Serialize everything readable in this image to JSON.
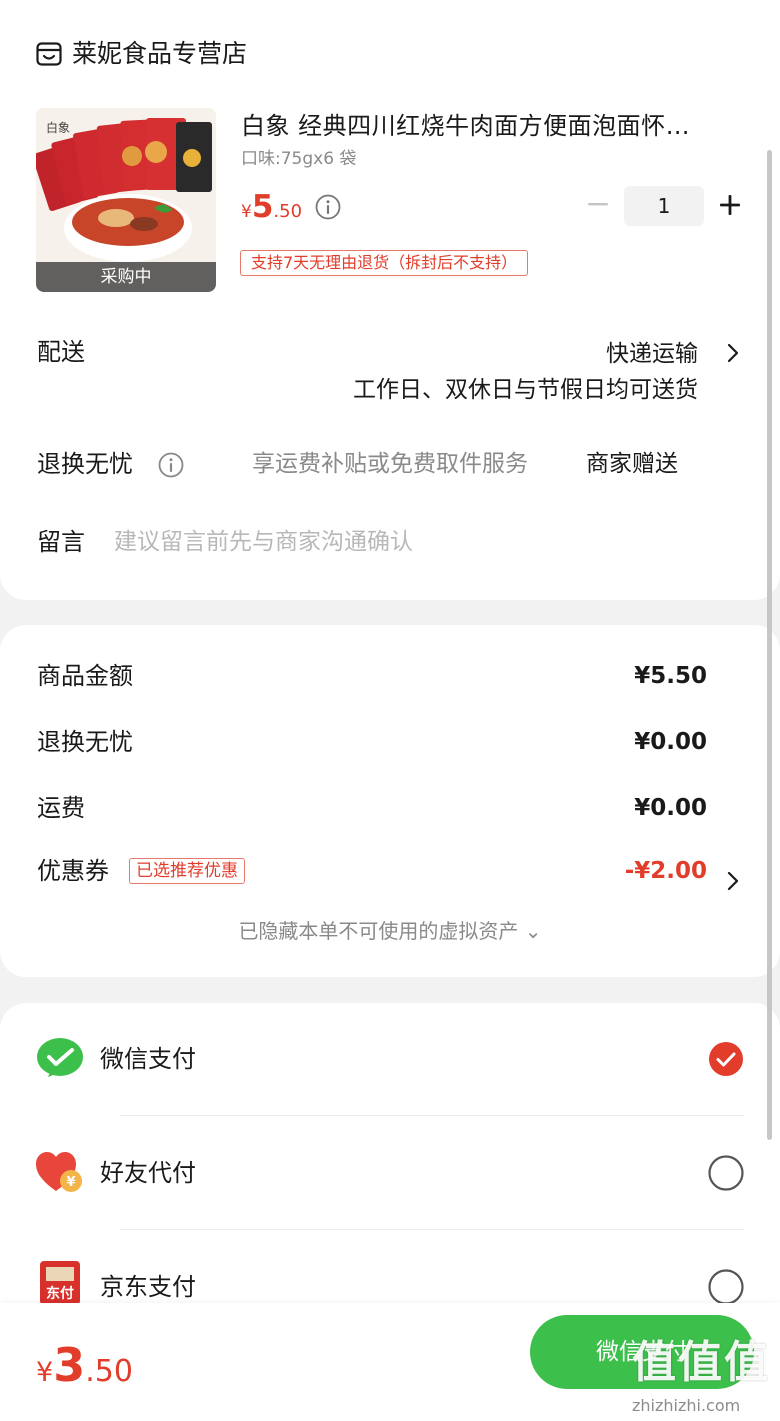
{
  "store": {
    "name": "莱妮食品专营店",
    "icon": "store-icon"
  },
  "product": {
    "title": "白象 经典四川红烧牛肉面方便面泡面怀…",
    "spec": "口味:75gx6 袋",
    "price_currency": "¥",
    "price_integer": "5",
    "price_decimal": ".50",
    "status_tag": "采购中",
    "quantity": "1",
    "return_policy": "支持7天无理由退货（拆封后不支持）"
  },
  "delivery": {
    "label": "配送",
    "method": "快递运输",
    "note": "工作日、双休日与节假日均可送货"
  },
  "return_worry_free": {
    "label": "退换无忧",
    "description": "享运费补贴或免费取件服务",
    "value": "商家赠送"
  },
  "message": {
    "label": "留言",
    "placeholder": "建议留言前先与商家沟通确认"
  },
  "summary": {
    "items": [
      {
        "label": "商品金额",
        "value": "¥5.50"
      },
      {
        "label": "退换无忧",
        "value": "¥0.00"
      },
      {
        "label": "运费",
        "value": "¥0.00"
      }
    ],
    "coupon": {
      "label": "优惠券",
      "tag": "已选推荐优惠",
      "value": "-¥2.00"
    },
    "hidden_assets": "已隐藏本单不可使用的虚拟资产 ⌄"
  },
  "payment_methods": [
    {
      "label": "微信支付",
      "icon": "wechat-pay-icon",
      "selected": true
    },
    {
      "label": "好友代付",
      "icon": "friend-pay-icon",
      "selected": false
    },
    {
      "label": "京东支付",
      "icon": "jd-pay-icon",
      "icon_text": "东付",
      "selected": false
    }
  ],
  "bottom_bar": {
    "total_currency": "¥",
    "total_integer": "3",
    "total_decimal": ".50",
    "pay_button": "微信支付"
  },
  "watermark": {
    "logo": "值值值",
    "url": "zhizhizhi.com"
  },
  "colors": {
    "accent_red": "#e23c2b",
    "wechat_green": "#3cc04b",
    "background": "#f2f2f2"
  }
}
